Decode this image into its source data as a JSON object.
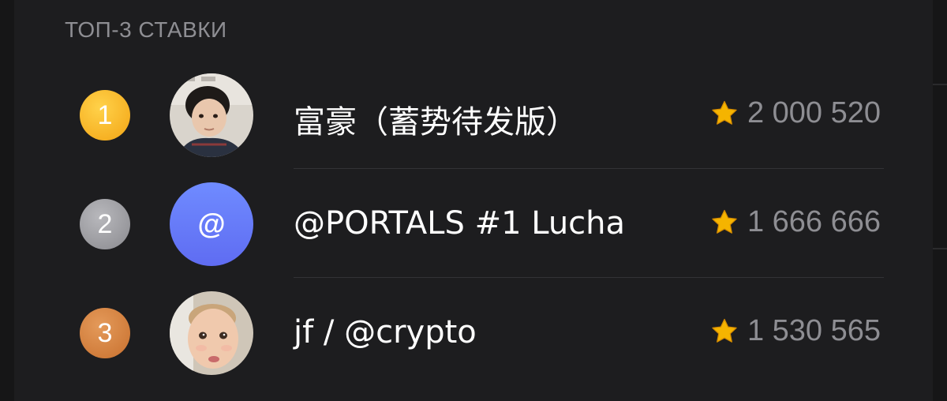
{
  "section": {
    "title": "ТОП-3 СТАВКИ"
  },
  "entries": [
    {
      "rank": "1",
      "name": "富豪（蓄势待发版）",
      "score": "2 000 520",
      "avatar_type": "photo-child"
    },
    {
      "rank": "2",
      "name": "@PORTALS #1 Lucha",
      "score": "1 666 666",
      "avatar_type": "at-symbol",
      "avatar_text": "@"
    },
    {
      "rank": "3",
      "name": "jf / @crypto",
      "score": "1 530 565",
      "avatar_type": "photo-toddler"
    }
  ],
  "icons": {
    "star": "star-icon"
  },
  "colors": {
    "gold": "#f3a414",
    "silver": "#8a8a8f",
    "bronze": "#c8702e",
    "at_avatar": "#6a7cf8",
    "star": "#f5b400"
  }
}
